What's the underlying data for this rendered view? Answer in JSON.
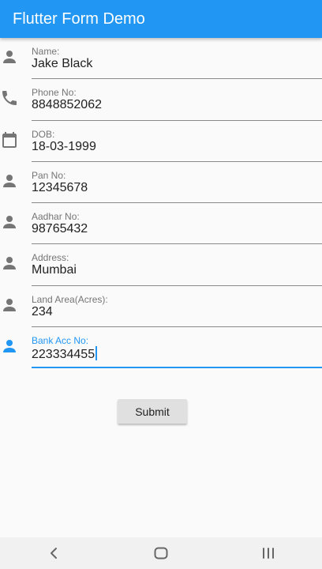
{
  "app": {
    "title": "Flutter Form Demo",
    "accent_color": "#2196f3"
  },
  "form": {
    "fields": [
      {
        "label": "Name:",
        "value": "Jake Black",
        "icon": "person-icon"
      },
      {
        "label": "Phone No:",
        "value": "8848852062",
        "icon": "phone-icon"
      },
      {
        "label": "DOB:",
        "value": "18-03-1999",
        "icon": "calendar-icon"
      },
      {
        "label": "Pan No:",
        "value": "12345678",
        "icon": "person-icon"
      },
      {
        "label": "Aadhar No:",
        "value": "98765432",
        "icon": "person-icon"
      },
      {
        "label": "Address:",
        "value": "Mumbai",
        "icon": "person-icon"
      },
      {
        "label": "Land Area(Acres):",
        "value": "234",
        "icon": "person-icon"
      },
      {
        "label": "Bank Acc No:",
        "value": "223334455",
        "icon": "person-icon",
        "focused": true
      }
    ],
    "submit_label": "Submit"
  },
  "navbar": {
    "buttons": [
      "back-icon",
      "home-icon",
      "recents-icon"
    ]
  }
}
